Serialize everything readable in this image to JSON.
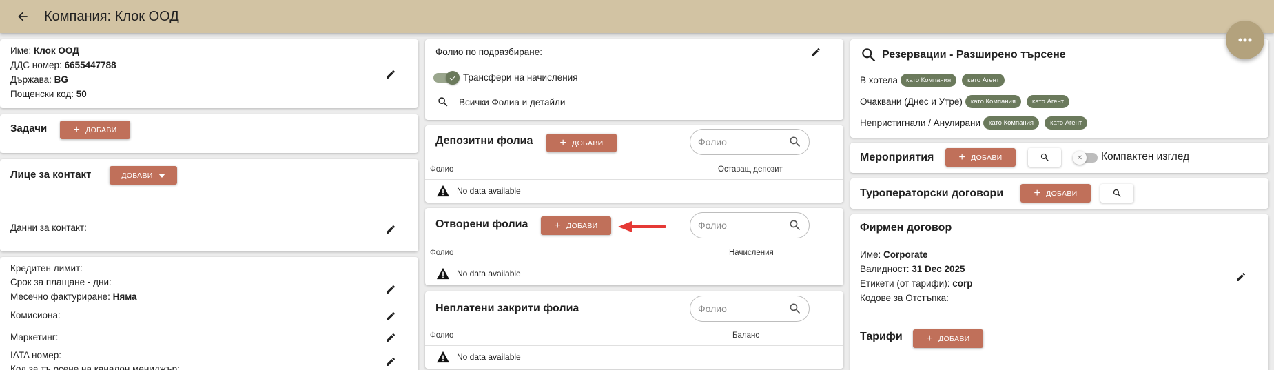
{
  "header": {
    "title": "Компания: Клок ООД"
  },
  "company": {
    "name_label": "Име:",
    "name_value": "Клок ООД",
    "vat_label": "ДДС номер:",
    "vat_value": "6655447788",
    "country_label": "Държава:",
    "country_value": "BG",
    "postal_label": "Пощенски код:",
    "postal_value": "50"
  },
  "tasks": {
    "title": "Задачи",
    "add_label": "ДОБАВИ"
  },
  "contact_person": {
    "title": "Лице за контакт",
    "add_label": "ДОБАВИ",
    "contact_data_label": "Данни за контакт:"
  },
  "finance": {
    "credit_limit_label": "Кредитен лимит:",
    "payment_term_label": "Срок за плащане - дни:",
    "monthly_billing_label": "Месечно фактуриране:",
    "monthly_billing_value": "Няма",
    "commission_label": "Комисиона:",
    "marketing_label": "Маркетинг:",
    "iata_label": "IATA номер:",
    "channel_manager_label": "Код за тъ рсене на каналон мениджър:"
  },
  "folio_defaults": {
    "default_folio_label": "Фолио по подразбиране:",
    "transfer_charges_label": "Трансфери на начисления",
    "transfer_charges_on": true,
    "all_folios_label": "Всички Фолиа и детайли"
  },
  "deposit_folios": {
    "title": "Депозитни фолиа",
    "add_label": "ДОБАВИ",
    "search_placeholder": "Фолио",
    "col_folio": "Фолио",
    "col_value": "Оставащ депозит",
    "empty": "No data available"
  },
  "open_folios": {
    "title": "Отворени фолиа",
    "add_label": "ДОБАВИ",
    "search_placeholder": "Фолио",
    "col_folio": "Фолио",
    "col_value": "Начисления",
    "empty": "No data available"
  },
  "unpaid_folios": {
    "title": "Неплатени закрити фолиа",
    "search_placeholder": "Фолио",
    "col_folio": "Фолио",
    "col_value": "Баланс",
    "empty": "No data available"
  },
  "reservations": {
    "title": "Резервации - Разширено търсене",
    "rows": [
      {
        "label": "В хотела",
        "chip_company": "като Компания",
        "chip_agent": "като Агент"
      },
      {
        "label": "Очаквани (Днес и Утре)",
        "chip_company": "като Компания",
        "chip_agent": "като Агент"
      },
      {
        "label": "Непристигнали / Анулирани",
        "chip_company": "като Компания",
        "chip_agent": "като Агент"
      }
    ]
  },
  "events": {
    "title": "Мероприятия",
    "add_label": "ДОБАВИ",
    "compact_label": "Компактен изглед",
    "compact_on": false
  },
  "tour_operator": {
    "title": "Туроператорски договори",
    "add_label": "ДОБАВИ"
  },
  "corporate_contract": {
    "title": "Фирмен договор",
    "name_label": "Име:",
    "name_value": "Corporate",
    "validity_label": "Валидност:",
    "validity_value": "31 Dec 2025",
    "tags_label": "Етикети (от тарифи):",
    "tags_value": "corp",
    "discount_codes_label": "Кодове за Отстъпка:"
  },
  "rates": {
    "title": "Тарифи",
    "add_label": "ДОБАВИ"
  },
  "colors": {
    "header_bg": "#d2c3a3",
    "accent_button": "#c0705a",
    "chip": "#6b7a5c",
    "fab": "#b3a27d",
    "arrow": "#e53935"
  }
}
